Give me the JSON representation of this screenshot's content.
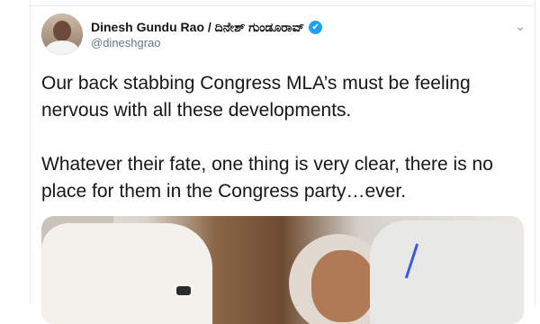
{
  "tweet": {
    "display_name": "Dinesh Gundu Rao / ದಿನೇಶ್ ಗುಂಡೂರಾವ್",
    "handle": "@dineshgrao",
    "verified_icon": "✔",
    "caret_icon": "⌄",
    "text": "Our back stabbing Congress MLA’s must be feeling nervous with all these developments.\n\nWhatever their fate, one thing is very clear, there is no place for them in the Congress party…ever."
  },
  "colors": {
    "verified_blue": "#1da1f2",
    "handle_gray": "#657786",
    "text": "#14171a"
  }
}
